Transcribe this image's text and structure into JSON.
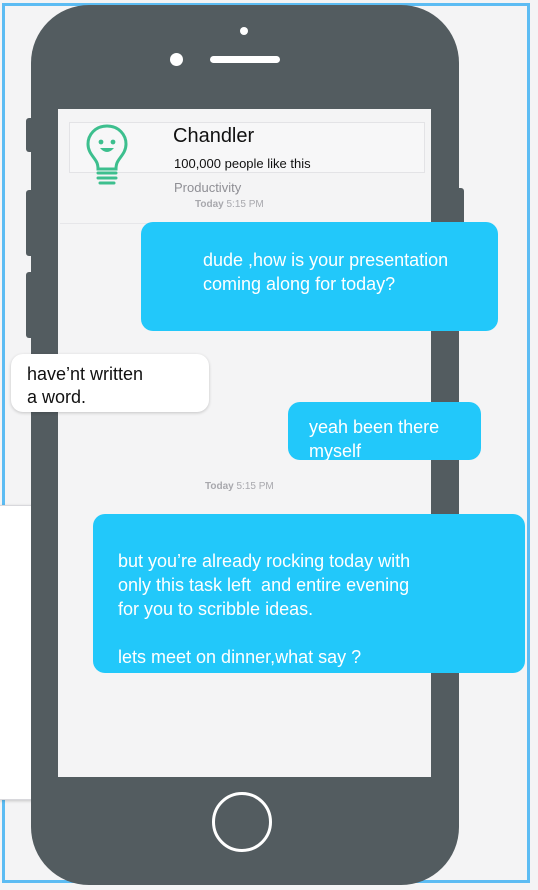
{
  "contact": {
    "name": "Chandler",
    "likes": "100,000 people like this",
    "category": "Productivity",
    "icon": "lightbulb-icon"
  },
  "timestamps": [
    {
      "day": "Today",
      "time": "5:15 PM"
    },
    {
      "day": "Today",
      "time": "5:15 PM"
    }
  ],
  "messages": [
    {
      "direction": "outgoing",
      "text": "dude ,how is your presentation\ncoming along for today?"
    },
    {
      "direction": "incoming",
      "text": "have’nt written\na word."
    },
    {
      "direction": "outgoing",
      "text": "yeah been there\nmyself"
    },
    {
      "direction": "outgoing",
      "text": "but you’re already rocking today with\nonly this task left  and entire evening\nfor you to scribble ideas.\n\nlets meet on dinner,what say ?"
    }
  ],
  "colors": {
    "frame": "#5cbcf3",
    "phone_body": "#535c60",
    "outgoing_bubble": "#22c8fa",
    "incoming_bubble": "#ffffff",
    "bulb": "#3dbf8e"
  }
}
